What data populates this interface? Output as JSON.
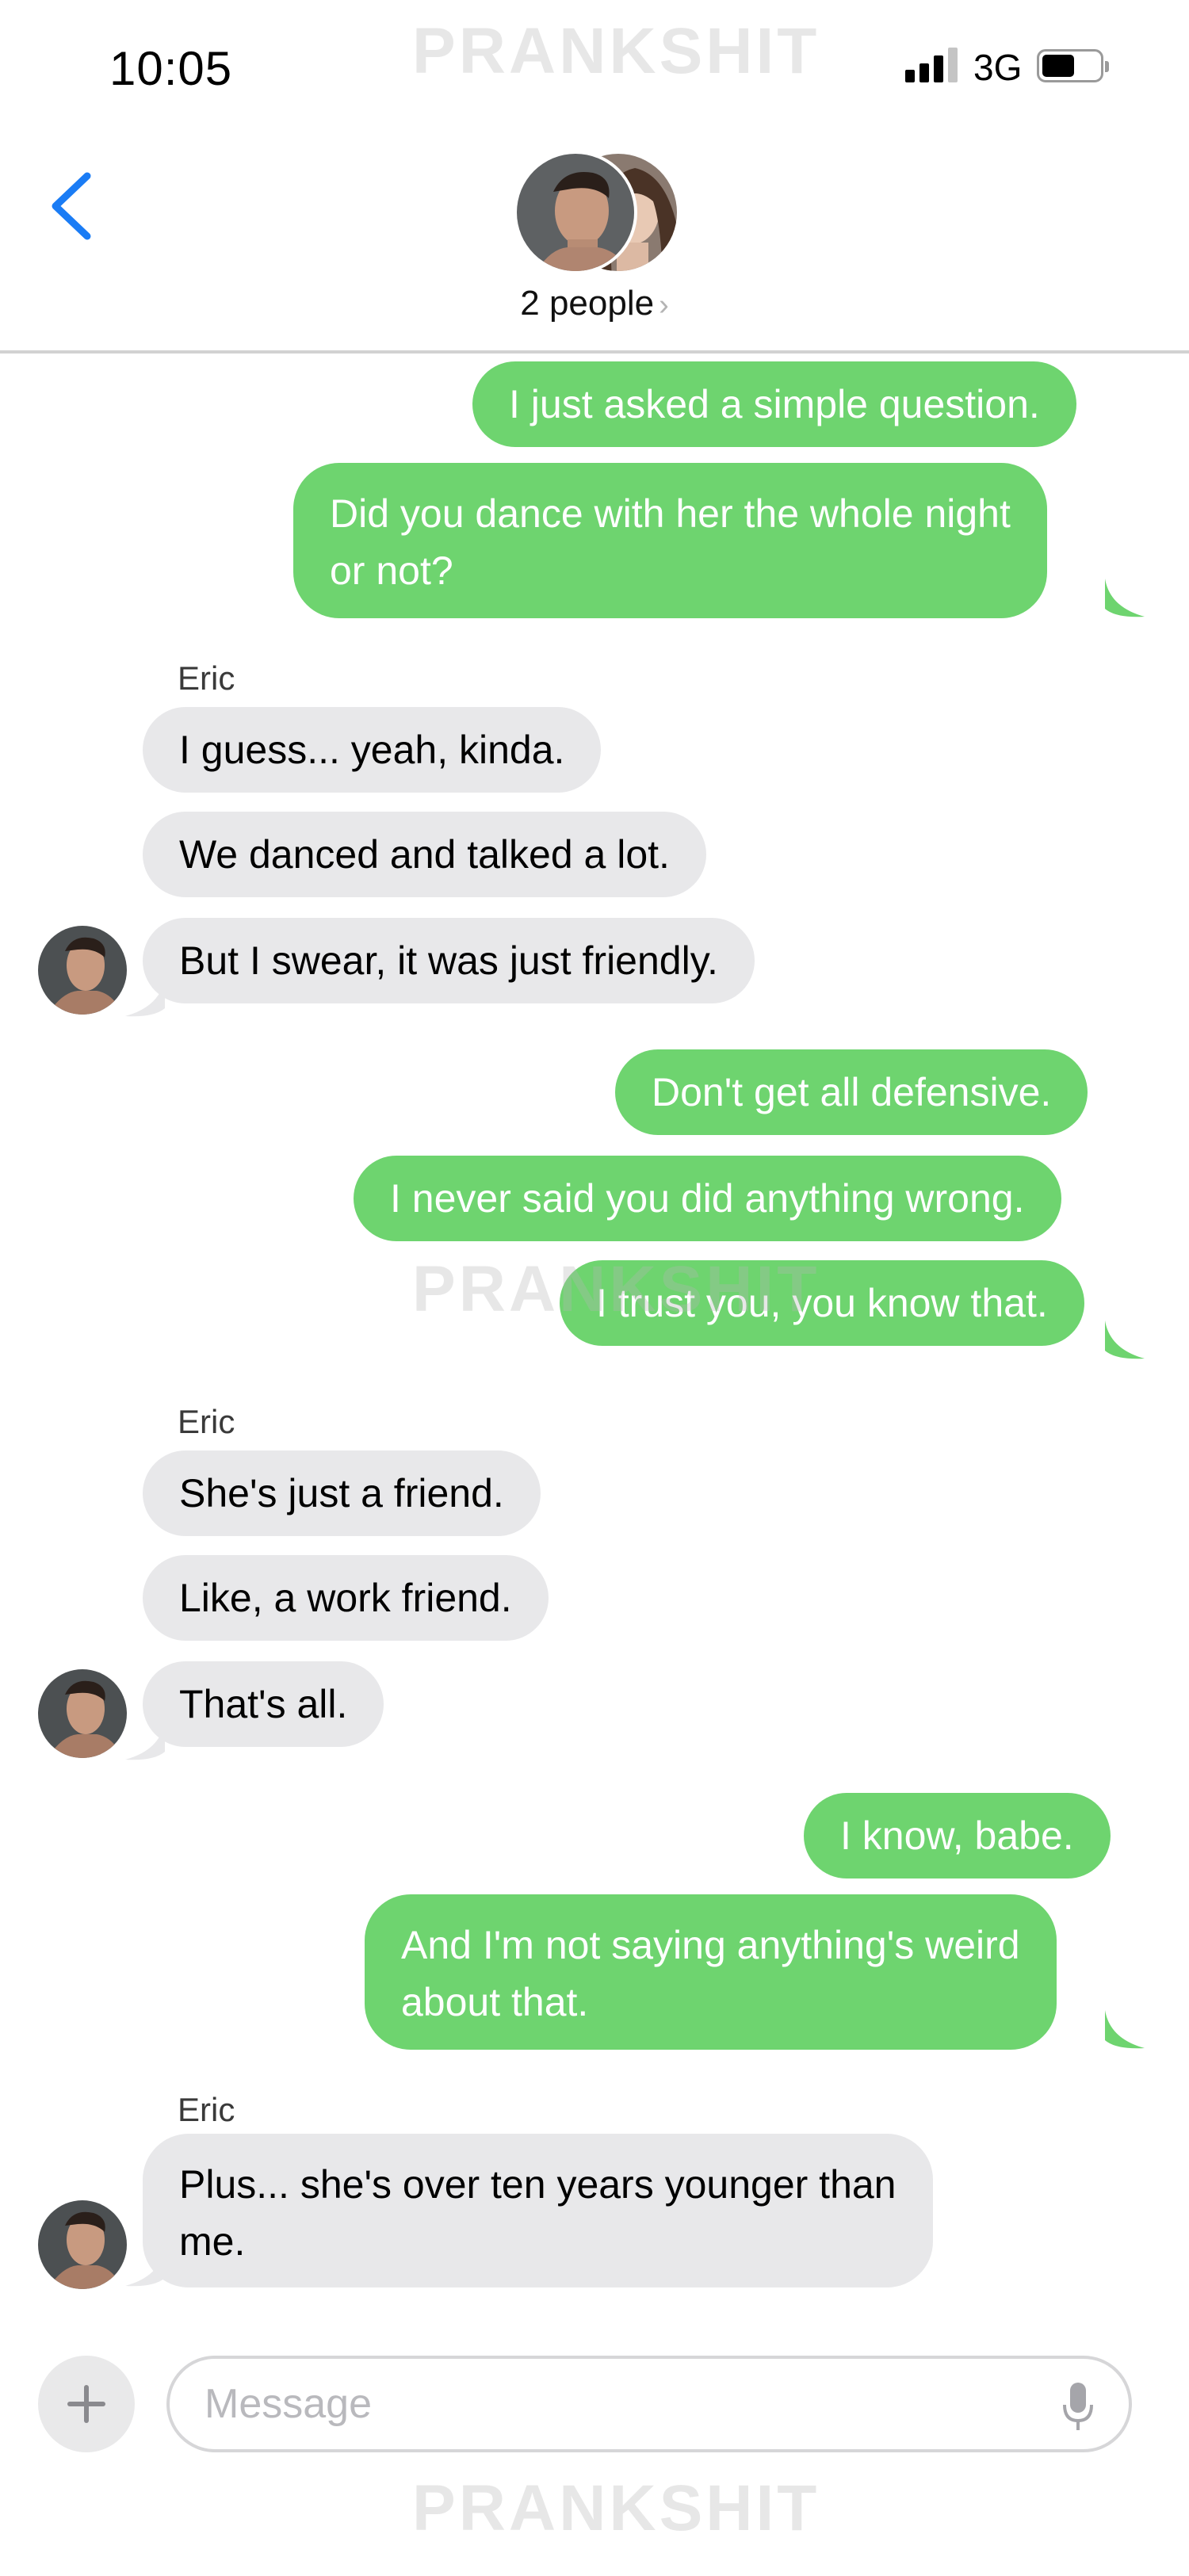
{
  "status_bar": {
    "time": "10:05",
    "network": "3G"
  },
  "watermark_text": "PRANKSHIT",
  "header": {
    "group_label": "2 people",
    "chevron": "›"
  },
  "thread": [
    {
      "direction": "out",
      "text": "I just asked a simple question."
    },
    {
      "direction": "out",
      "text": "Did you dance with her the whole night",
      "text2": "or not?"
    },
    {
      "direction": "in",
      "sender": "Eric",
      "text": "I guess... yeah, kinda."
    },
    {
      "direction": "in",
      "text": "We danced and talked a lot."
    },
    {
      "direction": "in",
      "text": "But I swear, it was just friendly."
    },
    {
      "direction": "out",
      "text": "Don't get all defensive."
    },
    {
      "direction": "out",
      "text": "I never said you did anything wrong."
    },
    {
      "direction": "out",
      "text": "I trust you, you know that."
    },
    {
      "direction": "in",
      "sender": "Eric",
      "text": "She's just a friend."
    },
    {
      "direction": "in",
      "text": "Like, a work friend."
    },
    {
      "direction": "in",
      "text": "That's all."
    },
    {
      "direction": "out",
      "text": "I know, babe."
    },
    {
      "direction": "out",
      "text": "And I'm not saying anything's weird",
      "text2": "about that."
    },
    {
      "direction": "in",
      "sender": "Eric",
      "text": "Plus... she's over ten years younger than",
      "text2": "me."
    }
  ],
  "composer": {
    "placeholder": "Message",
    "value": ""
  },
  "icons": {
    "back": "chevron-left-icon",
    "add": "plus-icon",
    "mic": "microphone-icon"
  },
  "colors": {
    "outgoing_bubble": "#6ed46f",
    "incoming_bubble": "#e8e8ea",
    "accent": "#1a7cf5"
  }
}
